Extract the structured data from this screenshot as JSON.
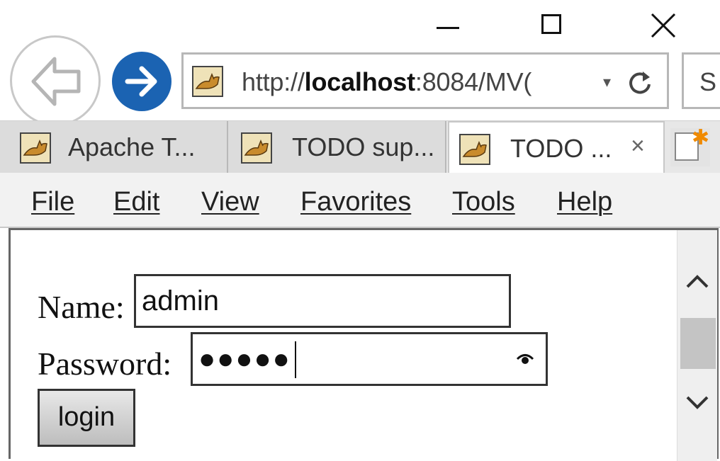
{
  "window": {
    "minimize_icon": "minimize-icon",
    "maximize_icon": "maximize-icon",
    "close_icon": "close-icon"
  },
  "nav": {
    "back_icon": "back-arrow-icon",
    "forward_icon": "forward-arrow-icon",
    "address": {
      "prefix": "http://",
      "host": "localhost",
      "suffix": ":8084/MV("
    },
    "dropdown_glyph": "▾",
    "search_text": "S"
  },
  "tabs": [
    {
      "label": "Apache T...",
      "icon": "tomcat-favicon-icon"
    },
    {
      "label": "TODO sup...",
      "icon": "tomcat-favicon-icon"
    },
    {
      "label": "TODO ...",
      "icon": "tomcat-favicon-icon",
      "close": "×",
      "active": true
    }
  ],
  "menu": {
    "file": "File",
    "edit": "Edit",
    "view": "View",
    "favorites": "Favorites",
    "tools": "Tools",
    "help": "Help"
  },
  "form": {
    "name_label": "Name:",
    "name_value": "admin",
    "password_label": "Password:",
    "password_masked": "●●●●●",
    "login_label": "login"
  },
  "colors": {
    "forward_button": "#1b63b2",
    "tab_strip": "#e7e7e7",
    "menu_bar": "#f2f2f2"
  }
}
